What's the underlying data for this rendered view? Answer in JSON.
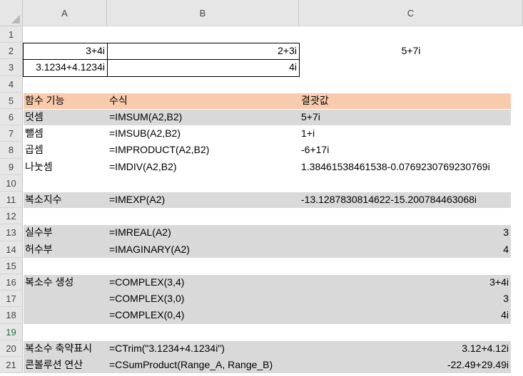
{
  "columns": [
    "A",
    "B",
    "C"
  ],
  "rows": [
    "1",
    "2",
    "3",
    "4",
    "5",
    "6",
    "7",
    "8",
    "9",
    "10",
    "11",
    "12",
    "13",
    "14",
    "15",
    "16",
    "17",
    "18",
    "19",
    "20",
    "21"
  ],
  "selected_row": "19",
  "colors": {
    "header_fill": "#f8cbad",
    "band_fill": "#d9d9d9"
  },
  "input": {
    "A2": "3+4i",
    "B2": "2+3i",
    "C2": "5+7i",
    "A3": "3.1234+4.1234i",
    "B3": "4i"
  },
  "header": {
    "func": "함수 기능",
    "formula": "수식",
    "result": "결괏값"
  },
  "table": [
    {
      "row": 6,
      "func": "덧셈",
      "formula": "=IMSUM(A2,B2)",
      "result": "5+7i",
      "align": "left"
    },
    {
      "row": 7,
      "func": "뺄셈",
      "formula": "=IMSUB(A2,B2)",
      "result": "1+i",
      "align": "left"
    },
    {
      "row": 8,
      "func": "곱셈",
      "formula": "=IMPRODUCT(A2,B2)",
      "result": "-6+17i",
      "align": "left"
    },
    {
      "row": 9,
      "func": "나눗셈",
      "formula": "=IMDIV(A2,B2)",
      "result": "1.38461538461538-0.0769230769230769i",
      "align": "left"
    },
    {
      "row": 11,
      "func": "복소지수",
      "formula": "=IMEXP(A2)",
      "result": "-13.1287830814622-15.200784463068i",
      "align": "left"
    },
    {
      "row": 13,
      "func": "실수부",
      "formula": "=IMREAL(A2)",
      "result": "3",
      "align": "right"
    },
    {
      "row": 14,
      "func": "허수부",
      "formula": "=IMAGINARY(A2)",
      "result": "4",
      "align": "right"
    },
    {
      "row": 16,
      "func": "복소수 생성",
      "formula": "=COMPLEX(3,4)",
      "result": "3+4i",
      "align": "right"
    },
    {
      "row": 17,
      "func": "",
      "formula": "=COMPLEX(3,0)",
      "result": "3",
      "align": "right"
    },
    {
      "row": 18,
      "func": "",
      "formula": "=COMPLEX(0,4)",
      "result": "4i",
      "align": "right"
    },
    {
      "row": 20,
      "func": "복소수 축약표시",
      "formula": "=CTrim(\"3.1234+4.1234i\")",
      "result": "3.12+4.12i",
      "align": "right"
    },
    {
      "row": 21,
      "func": "콘볼루션 연산",
      "formula": "=CSumProduct(Range_A, Range_B)",
      "result": "-22.49+29.49i",
      "align": "right"
    }
  ]
}
